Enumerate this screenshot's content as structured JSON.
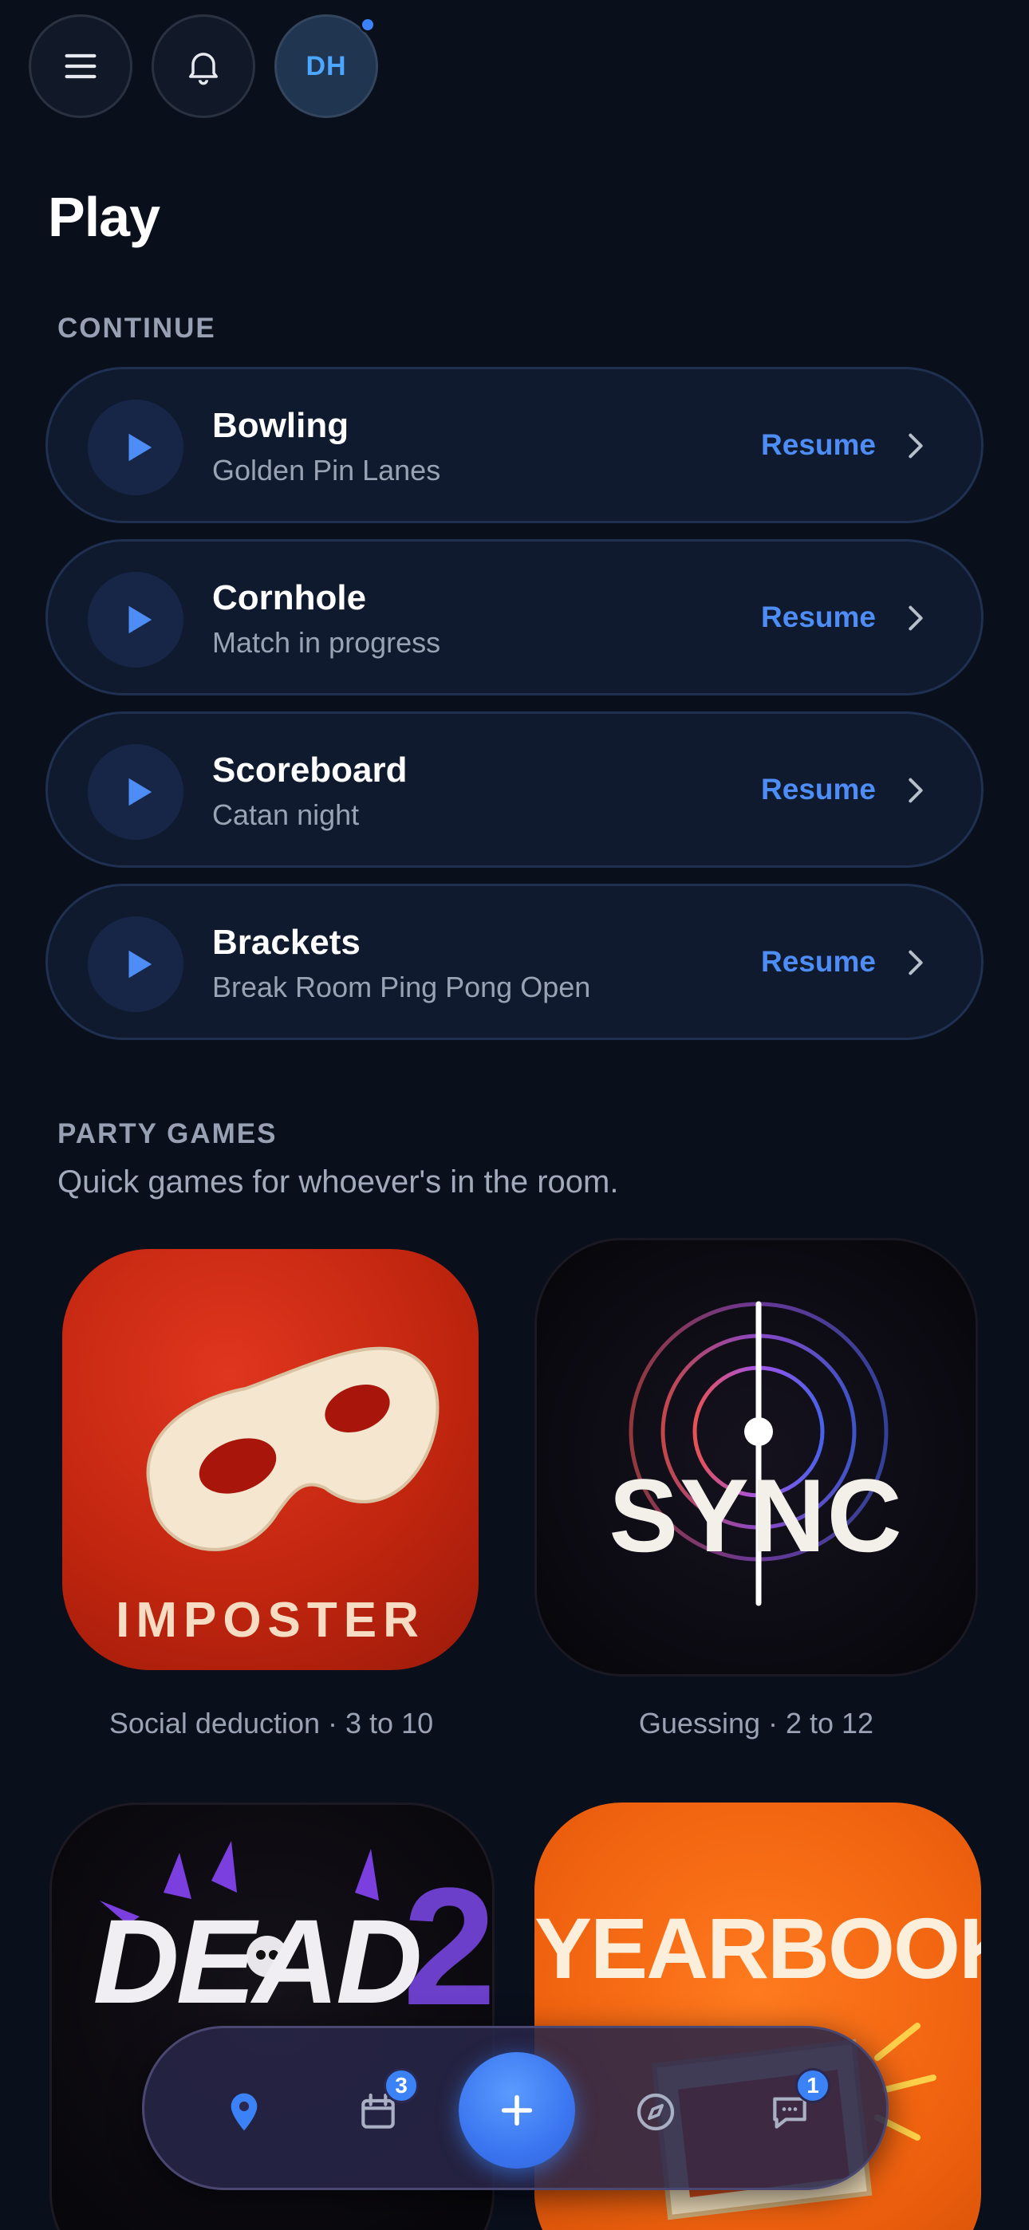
{
  "header": {
    "menu_icon": "hamburger-menu-icon",
    "notifications_icon": "bell-icon",
    "avatar_initials": "DH"
  },
  "page_title": "Play",
  "continue": {
    "label": "CONTINUE",
    "items": [
      {
        "title": "Bowling",
        "subtitle": "Golden Pin Lanes",
        "action": "Resume"
      },
      {
        "title": "Cornhole",
        "subtitle": "Match in progress",
        "action": "Resume"
      },
      {
        "title": "Scoreboard",
        "subtitle": "Catan night",
        "action": "Resume"
      },
      {
        "title": "Brackets",
        "subtitle": "Break Room Ping Pong Open",
        "action": "Resume"
      }
    ]
  },
  "party_games": {
    "label": "PARTY GAMES",
    "subtitle": "Quick games for whoever's in the room.",
    "games": [
      {
        "logo_text": "IMPOSTER",
        "caption": "Social deduction · 3 to 10"
      },
      {
        "logo_text": "SYNC",
        "caption": "Guessing · 2 to 12"
      },
      {
        "logo_text": "DEAD"
      },
      {
        "logo_text": "YEARBOOK"
      }
    ]
  },
  "bottom_nav": {
    "calendar_badge": "3",
    "messages_badge": "1"
  },
  "colors": {
    "background": "#0a0f1c",
    "accent": "#4d8df5",
    "card": "#101a2e",
    "imposter_bg": "#c2260f",
    "yearbook_bg": "#f0620f"
  }
}
